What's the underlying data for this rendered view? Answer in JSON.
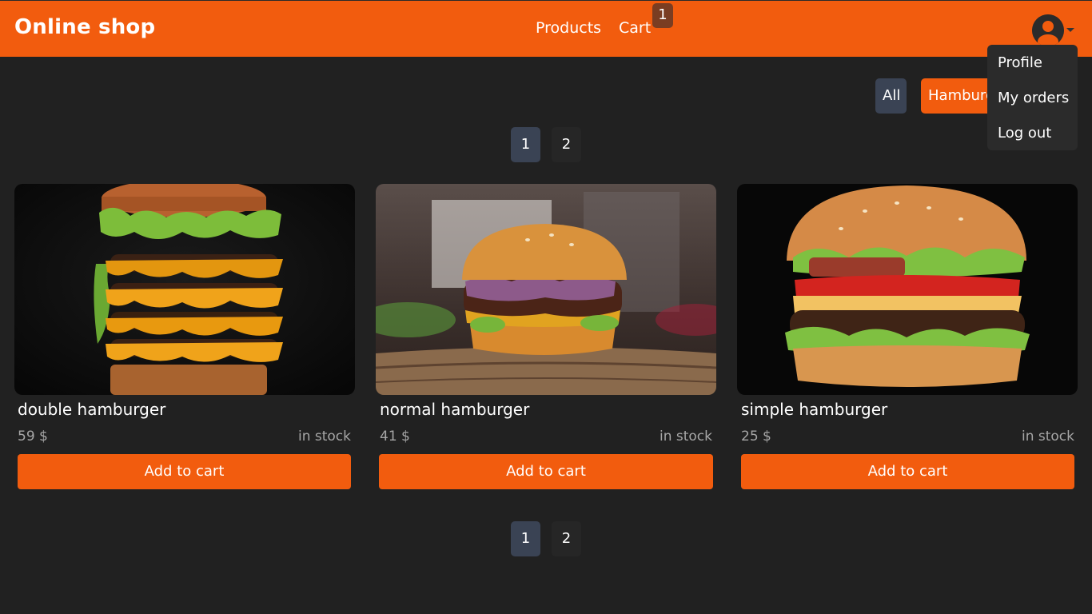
{
  "header": {
    "brand": "Online shop",
    "nav": {
      "products": "Products",
      "cart": "Cart"
    },
    "cart_count": "1",
    "avatar_icon": "user-circle-icon",
    "caret_icon": "chevron-down-icon"
  },
  "user_menu": {
    "items": [
      "Profile",
      "My orders",
      "Log out"
    ]
  },
  "filters": {
    "all": "All",
    "hamburger": "Hamburger"
  },
  "pagination": {
    "pages": [
      "1",
      "2"
    ],
    "active": "1"
  },
  "products": [
    {
      "name": "double hamburger",
      "price": "59 $",
      "stock": "in stock",
      "button": "Add to cart"
    },
    {
      "name": "normal hamburger",
      "price": "41 $",
      "stock": "in stock",
      "button": "Add to cart"
    },
    {
      "name": "simple hamburger",
      "price": "25 $",
      "stock": "in stock",
      "button": "Add to cart"
    }
  ],
  "colors": {
    "accent": "#f25c0e",
    "background": "#212121",
    "active_page": "#3a4354",
    "badge": "#7a3d22"
  }
}
